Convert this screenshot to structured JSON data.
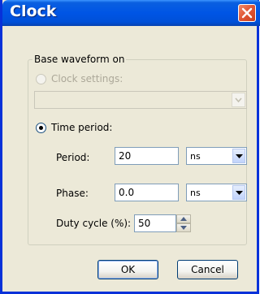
{
  "window": {
    "title": "Clock"
  },
  "group": {
    "legend": "Base waveform on",
    "clock_settings_label": "Clock settings:",
    "clock_settings_value": "",
    "time_period_label": "Time period:"
  },
  "period": {
    "label": "Period:",
    "value": "20",
    "unit": "ns"
  },
  "phase": {
    "label": "Phase:",
    "value": "0.0",
    "unit": "ns"
  },
  "duty": {
    "label": "Duty cycle (%):",
    "value": "50"
  },
  "buttons": {
    "ok": "OK",
    "cancel": "Cancel"
  },
  "selected_option": "time-period",
  "colors": {
    "titlebar": "#0055e5",
    "dialog_bg": "#ece9d8",
    "close": "#e05533"
  }
}
